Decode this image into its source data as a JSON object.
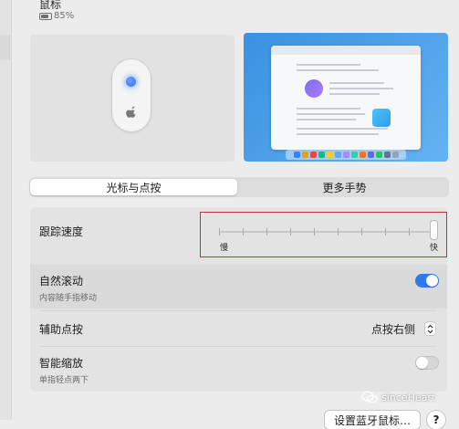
{
  "device": {
    "name": "鼠标",
    "battery": "85%"
  },
  "tabs": {
    "items": [
      "光标与点按",
      "更多手势"
    ],
    "selected": "光标与点按"
  },
  "tracking": {
    "label": "跟踪速度",
    "slow_label": "慢",
    "fast_label": "快",
    "value": 1.0
  },
  "natural_scroll": {
    "label": "自然滚动",
    "description": "内容随手指移动",
    "enabled": true
  },
  "secondary_click": {
    "label": "辅助点按",
    "value": "点按右侧"
  },
  "smart_zoom": {
    "label": "智能缩放",
    "description": "单指轻点两下",
    "enabled": false
  },
  "footer": {
    "bluetooth_button": "设置蓝牙鼠标…",
    "help_button": "?"
  },
  "watermark": {
    "text": "sinceHeart"
  },
  "colors": {
    "accent": "#2f79e9",
    "highlight_border": "#c22e3c",
    "dock_icons": [
      "#3b82f6",
      "#f59e0b",
      "#ef4444",
      "#10b981",
      "#facc15",
      "#60a5fa",
      "#a78bfa",
      "#34d399",
      "#f97316",
      "#6366f1",
      "#22c55e",
      "#64748b",
      "#94a3b8"
    ]
  }
}
